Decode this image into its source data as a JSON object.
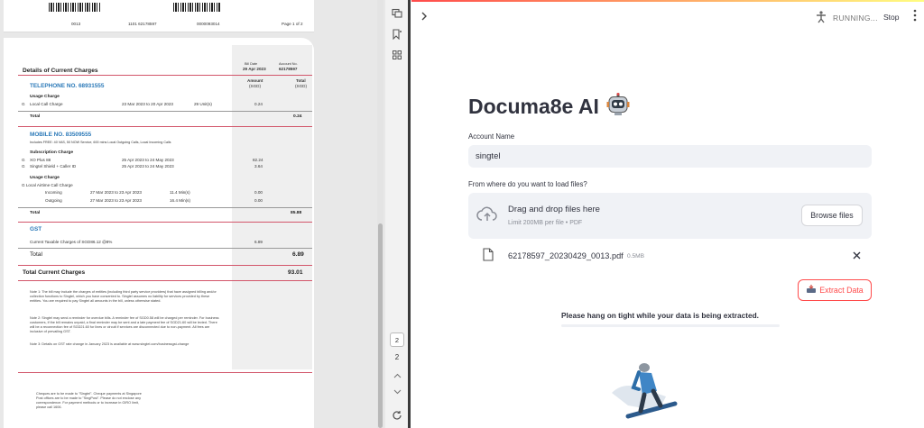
{
  "pdf_viewer": {
    "page1_footer": {
      "code1": "0013",
      "code2": "1101 62178597",
      "code3": "0000093014",
      "page_of": "Page 1 of 2"
    },
    "bill": {
      "section_title": "Details of Current Charges",
      "bill_date_label": "Bill Date",
      "bill_date": "29 Apr 2023",
      "account_no_label": "Account No.",
      "account_no": "62178597",
      "amount_label": "Amount",
      "amount_unit": "(SGD)",
      "total_label": "Total",
      "total_unit": "(SGD)",
      "telephone_heading": "TELEPHONE NO. 68931555",
      "usage_charge": "Usage Charge",
      "local_call_row": {
        "code": "G",
        "desc": "Local Call Charge",
        "period": "23 Mar 2023 to 20 Apr 2023",
        "units": "29 Unit(s)",
        "amount": "0.24"
      },
      "total_text": "Total",
      "tel_total": "0.24",
      "mobile_heading": "MOBILE NO. 83509555",
      "mobile_includes": "Includes FREE: 40 VAS, 50 NOW Service, 600 mins Local Outgoing Calls, Local Incoming Calls",
      "subscription_charge": "Subscription Charge",
      "sub_rows": [
        {
          "code": "G",
          "desc": "XO Plus 88",
          "period": "25 Apr 2023 to 24 May 2023",
          "amount": "82.24"
        },
        {
          "code": "G",
          "desc": "Singtel Shield + Caller ID",
          "period": "25 Apr 2023 to 24 May 2023",
          "amount": "3.64"
        }
      ],
      "usage_charge2": "Usage Charge",
      "local_airtime": "G   Local Airtime Call Charge",
      "airtime_rows": [
        {
          "desc": "Incoming",
          "period": "27 Mar 2023 to 23 Apr 2023",
          "units": "11.4 Min(s)",
          "amount": "0.00"
        },
        {
          "desc": "Outgoing",
          "period": "27 Mar 2023 to 23 Apr 2023",
          "units": "16.4 Min(s)",
          "amount": "0.00"
        }
      ],
      "mobile_total": "85.88",
      "gst_heading": "GST",
      "gst_desc": "Current Taxable Charges of SGD86.12 @8%",
      "gst_amount": "6.89",
      "gst_total": "6.89",
      "grand_total_label": "Total Current Charges",
      "grand_total": "93.01",
      "note1": "Note 1: The bill may include the charges of entities (including third party service providers) that have assigned billing and/or collection functions to Singtel, which you have consented to. Singtel assumes no liability for services provided by these entities. You are required to pay Singtel all amounts in the bill, unless otherwise stated.",
      "note2": "Note 2: Singtel may send a reminder for overdue bills. A reminder fee of SGD0.58 will be charged per reminder. For business customers, if the bill remains unpaid, a final reminder may be sent and a late payment fee of SGD21.60 will be levied. There will be a reconnection fee of SGD21.60 for lines or circuit if services are disconnected due to non-payment. All fees are inclusive of prevailing GST.",
      "note3": "Note 3: Details on GST rate change in January 2023 is available at www.singtel.com/businessgst-change",
      "cheque_note": "Cheques are to be made to \"Singtel\". Cheque payments at Singapore Post offices are to be made to \"SingPost\". Please do not enclose any correspondence. For payment methods or to increase in GIRO limit, please call 1606."
    }
  },
  "toolbar": {
    "page_current": "2",
    "page_label": "2"
  },
  "header": {
    "status": "RUNNING...",
    "stop": "Stop"
  },
  "main": {
    "title": "Documa8e AI",
    "account_label": "Account Name",
    "account_value": "singtel",
    "load_label": "From where do you want to load files?",
    "dropzone_title": "Drag and drop files here",
    "dropzone_limit": "Limit 200MB per file • PDF",
    "browse_button": "Browse files",
    "file_name": "62178597_20230429_0013.pdf",
    "file_size": "0.5MB",
    "extract_button": "Extract Data",
    "wait_message": "Please hang on tight while your data is being extracted."
  },
  "colors": {
    "accent": "#ff4b4b",
    "link_blue": "#2b79b8",
    "rule_red": "#d2556a"
  },
  "icons": [
    "comment-icon",
    "bookmark-icon",
    "grid-icon",
    "chevron-up-icon",
    "chevron-down-icon",
    "refresh-icon",
    "sidebar-chevron-icon",
    "running-person-icon",
    "menu-icon",
    "robot-icon",
    "cloud-upload-icon",
    "file-icon",
    "close-icon",
    "extract-icon"
  ]
}
